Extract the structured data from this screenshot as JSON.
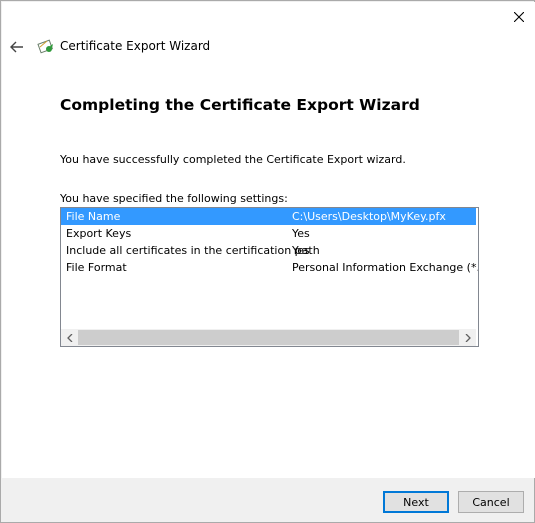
{
  "window": {
    "title": "Certificate Export Wizard",
    "heading": "Completing the Certificate Export Wizard",
    "message": "You have successfully completed the Certificate Export wizard.",
    "settings_label": "You have specified the following settings:"
  },
  "settings": [
    {
      "key": "File Name",
      "value": "C:\\Users\\Desktop\\MyKey.pfx"
    },
    {
      "key": "Export Keys",
      "value": "Yes"
    },
    {
      "key": "Include all certificates in the certification path",
      "value": "Yes"
    },
    {
      "key": "File Format",
      "value": "Personal Information Exchange (*.pfx)"
    }
  ],
  "buttons": {
    "next": "Next",
    "cancel": "Cancel"
  },
  "colors": {
    "selection": "#3399ff",
    "focus_border": "#0078d7"
  },
  "icons": {
    "close": "close-icon",
    "back": "back-arrow-icon",
    "app": "certificate-icon",
    "scroll_left": "scroll-left-icon",
    "scroll_right": "scroll-right-icon"
  }
}
